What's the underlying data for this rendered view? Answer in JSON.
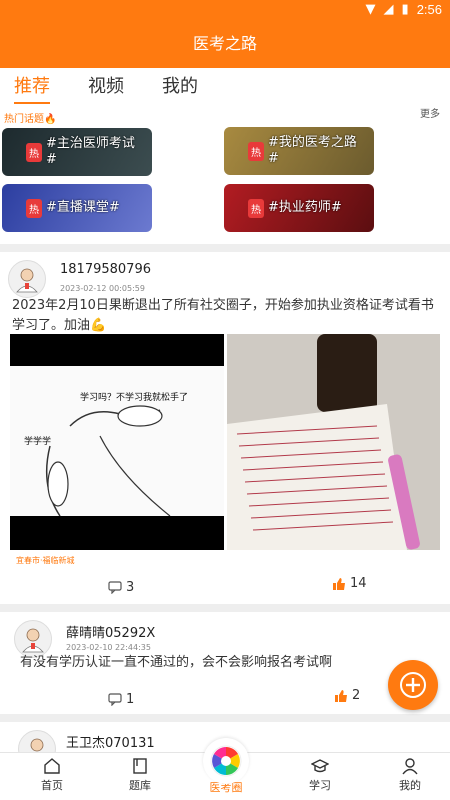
{
  "status_bar": {
    "time": "2:56"
  },
  "app": {
    "title": "医考之路"
  },
  "tabs": [
    {
      "label": "推荐",
      "active": true
    },
    {
      "label": "视频",
      "active": false
    },
    {
      "label": "我的",
      "active": false
    }
  ],
  "hot_topics": {
    "title": "热门话题",
    "more": "更多",
    "tag": "热",
    "items": [
      {
        "label": "#主治医师考试#"
      },
      {
        "label": "#我的医考之路#"
      },
      {
        "label": "#直播课堂#"
      },
      {
        "label": "#执业药师#"
      }
    ]
  },
  "posts": [
    {
      "username": "18179580796",
      "time": "2023-02-12 00:05:59",
      "content": "2023年2月10日果断退出了所有社交圈子，开始参加执业资格证考试看书学习了。加油💪",
      "image_text_top": "学习吗？不学习我就松手了",
      "image_text_left": "学学学",
      "location": "宜春市·福临新城",
      "comments": "3",
      "likes": "14"
    },
    {
      "username": "薛晴晴05292X",
      "time": "2023-02-10 22:44:35",
      "content": "有没有学历认证一直不通过的，会不会影响报名考试啊",
      "comments": "1",
      "likes": "2"
    },
    {
      "username": "王卫杰070131"
    }
  ],
  "bottom_nav": [
    {
      "label": "首页"
    },
    {
      "label": "题库"
    },
    {
      "label": "医考圈",
      "active": true
    },
    {
      "label": "学习"
    },
    {
      "label": "我的"
    }
  ],
  "colors": {
    "accent": "#ff7a10",
    "hot_tag": "#e83a3a"
  }
}
